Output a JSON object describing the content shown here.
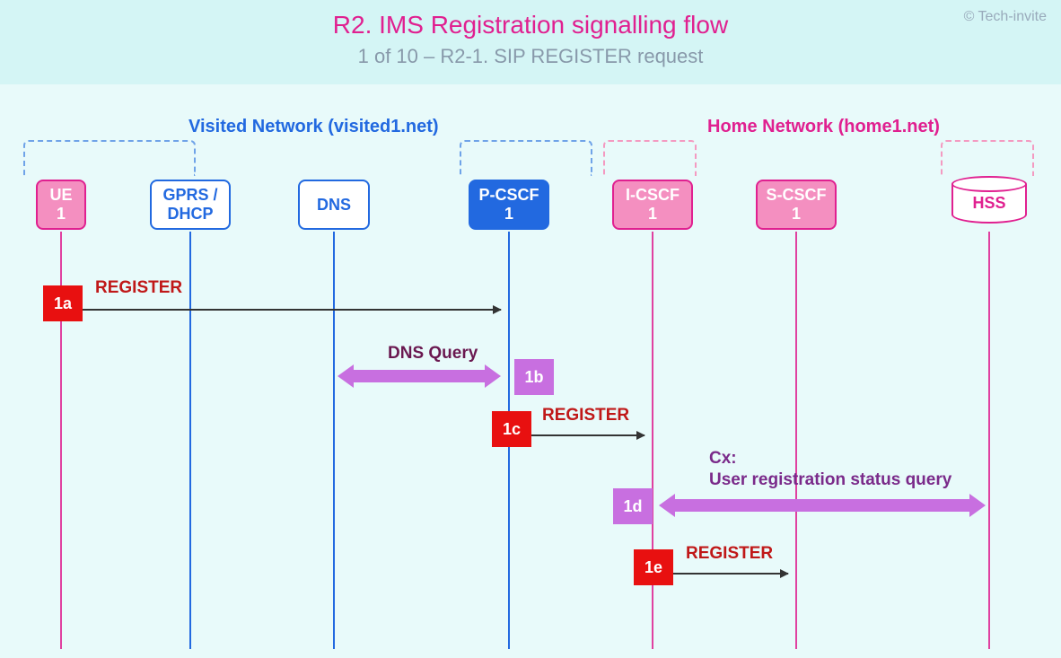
{
  "header": {
    "title": "R2. IMS Registration signalling flow",
    "subtitle": "1 of 10 – R2-1. SIP REGISTER request",
    "copyright": "© Tech-invite"
  },
  "networks": {
    "visited": "Visited Network (visited1.net)",
    "home": "Home Network (home1.net)"
  },
  "nodes": {
    "ue": {
      "line1": "UE",
      "line2": "1"
    },
    "gprs": {
      "line1": "GPRS /",
      "line2": "DHCP"
    },
    "dns": "DNS",
    "pcscf": {
      "line1": "P-CSCF",
      "line2": "1"
    },
    "icscf": {
      "line1": "I-CSCF",
      "line2": "1"
    },
    "scscf": {
      "line1": "S-CSCF",
      "line2": "1"
    },
    "hss": "HSS"
  },
  "steps": {
    "s1a": {
      "id": "1a",
      "label": "REGISTER"
    },
    "s1b": {
      "id": "1b",
      "label": "DNS Query"
    },
    "s1c": {
      "id": "1c",
      "label": "REGISTER"
    },
    "s1d": {
      "id": "1d",
      "label1": "Cx:",
      "label2": "User registration status query"
    },
    "s1e": {
      "id": "1e",
      "label": "REGISTER"
    }
  }
}
